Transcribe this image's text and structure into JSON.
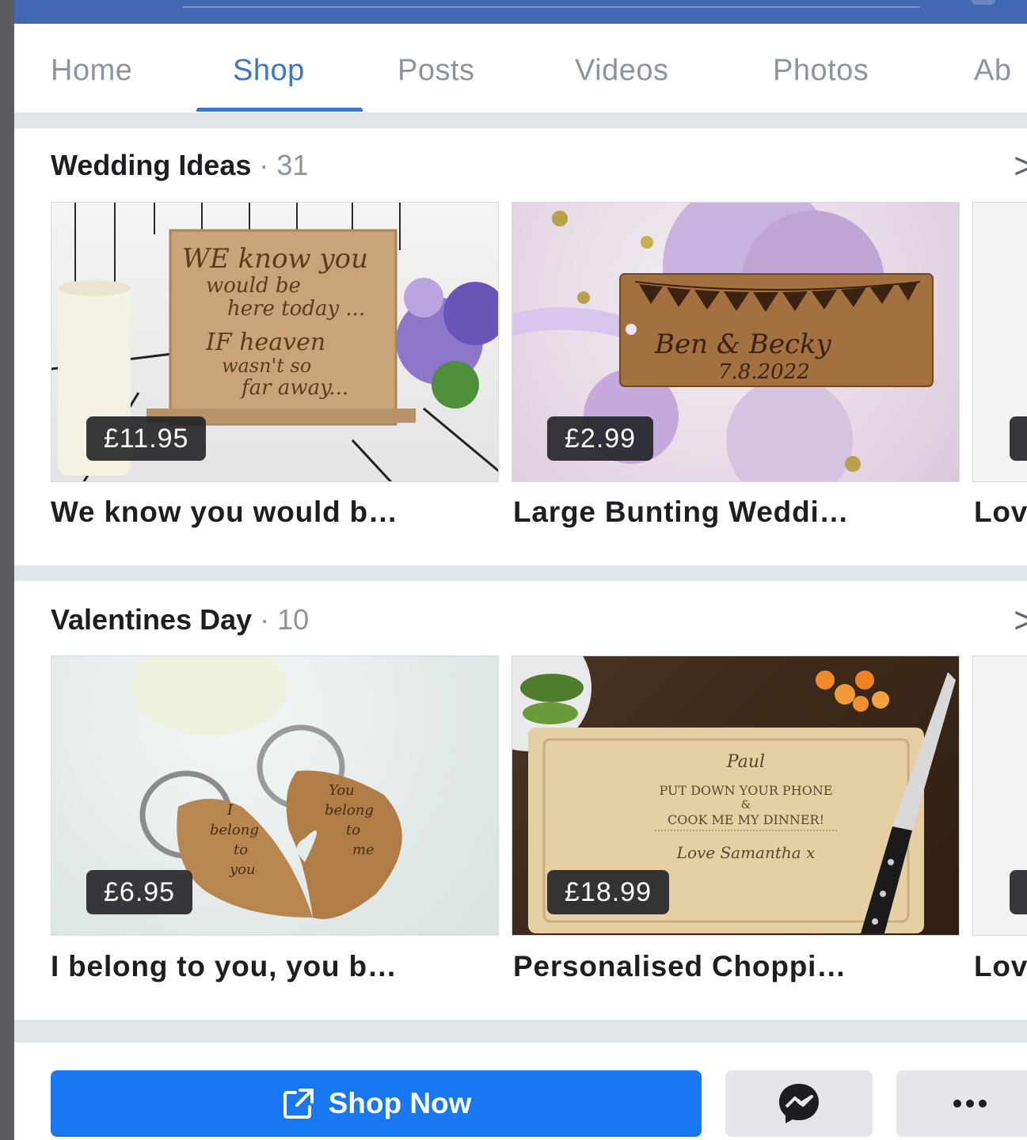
{
  "tabs": [
    {
      "label": "Home"
    },
    {
      "label": "Shop"
    },
    {
      "label": "Posts"
    },
    {
      "label": "Videos"
    },
    {
      "label": "Photos"
    },
    {
      "label": "Ab"
    }
  ],
  "sections": [
    {
      "title": "Wedding Ideas",
      "count": " · 31",
      "items": [
        {
          "price": "£11.95",
          "title": "We know you would b…",
          "art": [
            "WE know you",
            "would be",
            "here today ...",
            "IF heaven",
            "wasn't so",
            "far away..."
          ]
        },
        {
          "price": "£2.99",
          "title": "Large Bunting Weddi…",
          "art": [
            "Ben & Becky",
            "7.8.2022"
          ]
        },
        {
          "title": "Lov"
        }
      ]
    },
    {
      "title": "Valentines Day",
      "count": " · 10",
      "items": [
        {
          "price": "£6.95",
          "title": "I belong to you, you b…",
          "art": [
            "I",
            "belong",
            "to",
            "you",
            "You",
            "belong",
            "to",
            "me"
          ]
        },
        {
          "price": "£18.99",
          "title": "Personalised Choppi…",
          "art": [
            "Paul",
            "PUT DOWN YOUR PHONE",
            "&",
            "COOK ME MY DINNER!",
            "Love Samantha x"
          ]
        },
        {
          "title": "Lov"
        }
      ]
    }
  ],
  "actions": {
    "shop_now": "Shop Now",
    "messenger_icon": "messenger-icon",
    "more_icon": "more-icon"
  },
  "colors": {
    "header_blue": "#4267b2",
    "active_tab": "#3b76c9",
    "primary_button": "#1877f2"
  }
}
